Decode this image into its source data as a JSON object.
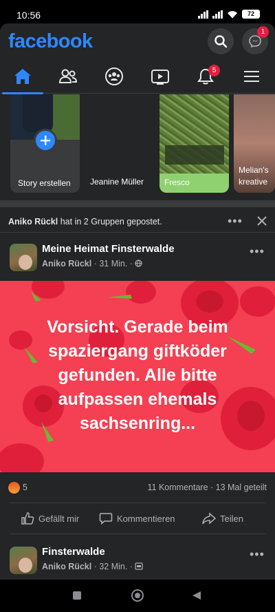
{
  "status": {
    "time": "10:56",
    "battery": "72"
  },
  "header": {
    "logo": "facebook",
    "messenger_badge": "1"
  },
  "tabs": [
    {
      "name": "home",
      "icon": "home-icon",
      "active": true
    },
    {
      "name": "friends",
      "icon": "friends-icon",
      "active": false
    },
    {
      "name": "groups",
      "icon": "groups-icon",
      "active": false
    },
    {
      "name": "watch",
      "icon": "video-icon",
      "active": false
    },
    {
      "name": "notifications",
      "icon": "bell-icon",
      "badge": "5",
      "active": false
    },
    {
      "name": "menu",
      "icon": "hamburger-icon",
      "active": false
    }
  ],
  "stories": [
    {
      "label": "Story erstellen"
    },
    {
      "label": "Jeanine Müller"
    },
    {
      "label": "Fresco"
    },
    {
      "label": "Melian's kreative"
    }
  ],
  "post": {
    "activity_user": "Aniko Rückl",
    "activity_text": "hat in 2 Gruppen gepostet.",
    "group": "Meine Heimat Finsterwalde",
    "author": "Aniko Rückl",
    "time": "31 Min.",
    "text": "Vorsicht. Gerade beim spaziergang giftköder gefunden. Alle bitte aufpassen ehemals sachsenring...",
    "reaction_count": "5",
    "comments": "11 Kommentare",
    "shares": "13 Mal geteilt",
    "actions": {
      "like": "Gefällt mir",
      "comment": "Kommentieren",
      "share": "Teilen"
    }
  },
  "post2": {
    "group": "Finsterwalde",
    "author": "Aniko Rückl",
    "time": "32 Min."
  }
}
